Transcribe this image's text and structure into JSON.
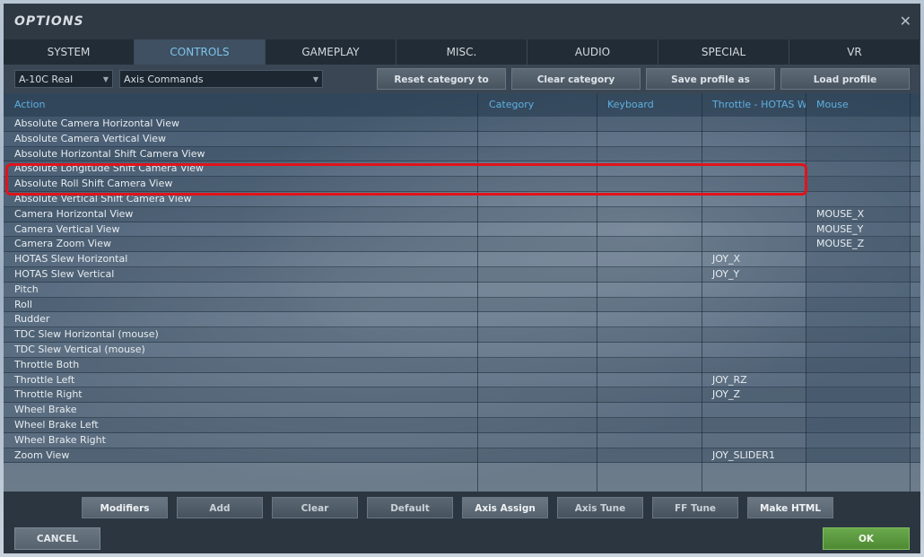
{
  "dialog": {
    "title": "OPTIONS",
    "close_glyph": "✕"
  },
  "tabs": [
    "SYSTEM",
    "CONTROLS",
    "GAMEPLAY",
    "MISC.",
    "AUDIO",
    "SPECIAL",
    "VR"
  ],
  "active_tab": "CONTROLS",
  "toolbar": {
    "aircraft_select": "A-10C Real",
    "category_select": "Axis Commands",
    "reset_label": "Reset category to default",
    "clear_category_label": "Clear category",
    "save_profile_label": "Save profile as",
    "load_profile_label": "Load profile"
  },
  "columns": [
    "Action",
    "Category",
    "Keyboard",
    "Throttle - HOTAS W...",
    "Mouse"
  ],
  "rows": [
    {
      "action": "Absolute Camera Horizontal View",
      "category": "",
      "keyboard": "",
      "throttle": "",
      "mouse": ""
    },
    {
      "action": "Absolute Camera Vertical View",
      "category": "",
      "keyboard": "",
      "throttle": "",
      "mouse": ""
    },
    {
      "action": "Absolute Horizontal Shift Camera View",
      "category": "",
      "keyboard": "",
      "throttle": "",
      "mouse": ""
    },
    {
      "action": "Absolute Longitude Shift Camera View",
      "category": "",
      "keyboard": "",
      "throttle": "",
      "mouse": ""
    },
    {
      "action": "Absolute Roll Shift Camera View",
      "category": "",
      "keyboard": "",
      "throttle": "",
      "mouse": ""
    },
    {
      "action": "Absolute Vertical Shift Camera View",
      "category": "",
      "keyboard": "",
      "throttle": "",
      "mouse": ""
    },
    {
      "action": "Camera Horizontal View",
      "category": "",
      "keyboard": "",
      "throttle": "",
      "mouse": "MOUSE_X"
    },
    {
      "action": "Camera Vertical View",
      "category": "",
      "keyboard": "",
      "throttle": "",
      "mouse": "MOUSE_Y"
    },
    {
      "action": "Camera Zoom View",
      "category": "",
      "keyboard": "",
      "throttle": "",
      "mouse": "MOUSE_Z"
    },
    {
      "action": "HOTAS Slew Horizontal",
      "category": "",
      "keyboard": "",
      "throttle": "JOY_X",
      "mouse": ""
    },
    {
      "action": "HOTAS Slew Vertical",
      "category": "",
      "keyboard": "",
      "throttle": "JOY_Y",
      "mouse": ""
    },
    {
      "action": "Pitch",
      "category": "",
      "keyboard": "",
      "throttle": "",
      "mouse": ""
    },
    {
      "action": "Roll",
      "category": "",
      "keyboard": "",
      "throttle": "",
      "mouse": ""
    },
    {
      "action": "Rudder",
      "category": "",
      "keyboard": "",
      "throttle": "",
      "mouse": ""
    },
    {
      "action": "TDC Slew Horizontal (mouse)",
      "category": "",
      "keyboard": "",
      "throttle": "",
      "mouse": ""
    },
    {
      "action": "TDC Slew Vertical (mouse)",
      "category": "",
      "keyboard": "",
      "throttle": "",
      "mouse": ""
    },
    {
      "action": "Throttle Both",
      "category": "",
      "keyboard": "",
      "throttle": "",
      "mouse": ""
    },
    {
      "action": "Throttle Left",
      "category": "",
      "keyboard": "",
      "throttle": "JOY_RZ",
      "mouse": ""
    },
    {
      "action": "Throttle Right",
      "category": "",
      "keyboard": "",
      "throttle": "JOY_Z",
      "mouse": ""
    },
    {
      "action": "Wheel Brake",
      "category": "",
      "keyboard": "",
      "throttle": "",
      "mouse": ""
    },
    {
      "action": "Wheel Brake Left",
      "category": "",
      "keyboard": "",
      "throttle": "",
      "mouse": ""
    },
    {
      "action": "Wheel Brake Right",
      "category": "",
      "keyboard": "",
      "throttle": "",
      "mouse": ""
    },
    {
      "action": "Zoom View",
      "category": "",
      "keyboard": "",
      "throttle": "JOY_SLIDER1",
      "mouse": ""
    }
  ],
  "bottom_buttons": [
    "Modifiers",
    "Add",
    "Clear",
    "Default",
    "Axis Assign",
    "Axis Tune",
    "FF Tune",
    "Make HTML"
  ],
  "footer": {
    "cancel_label": "CANCEL",
    "ok_label": "OK"
  }
}
